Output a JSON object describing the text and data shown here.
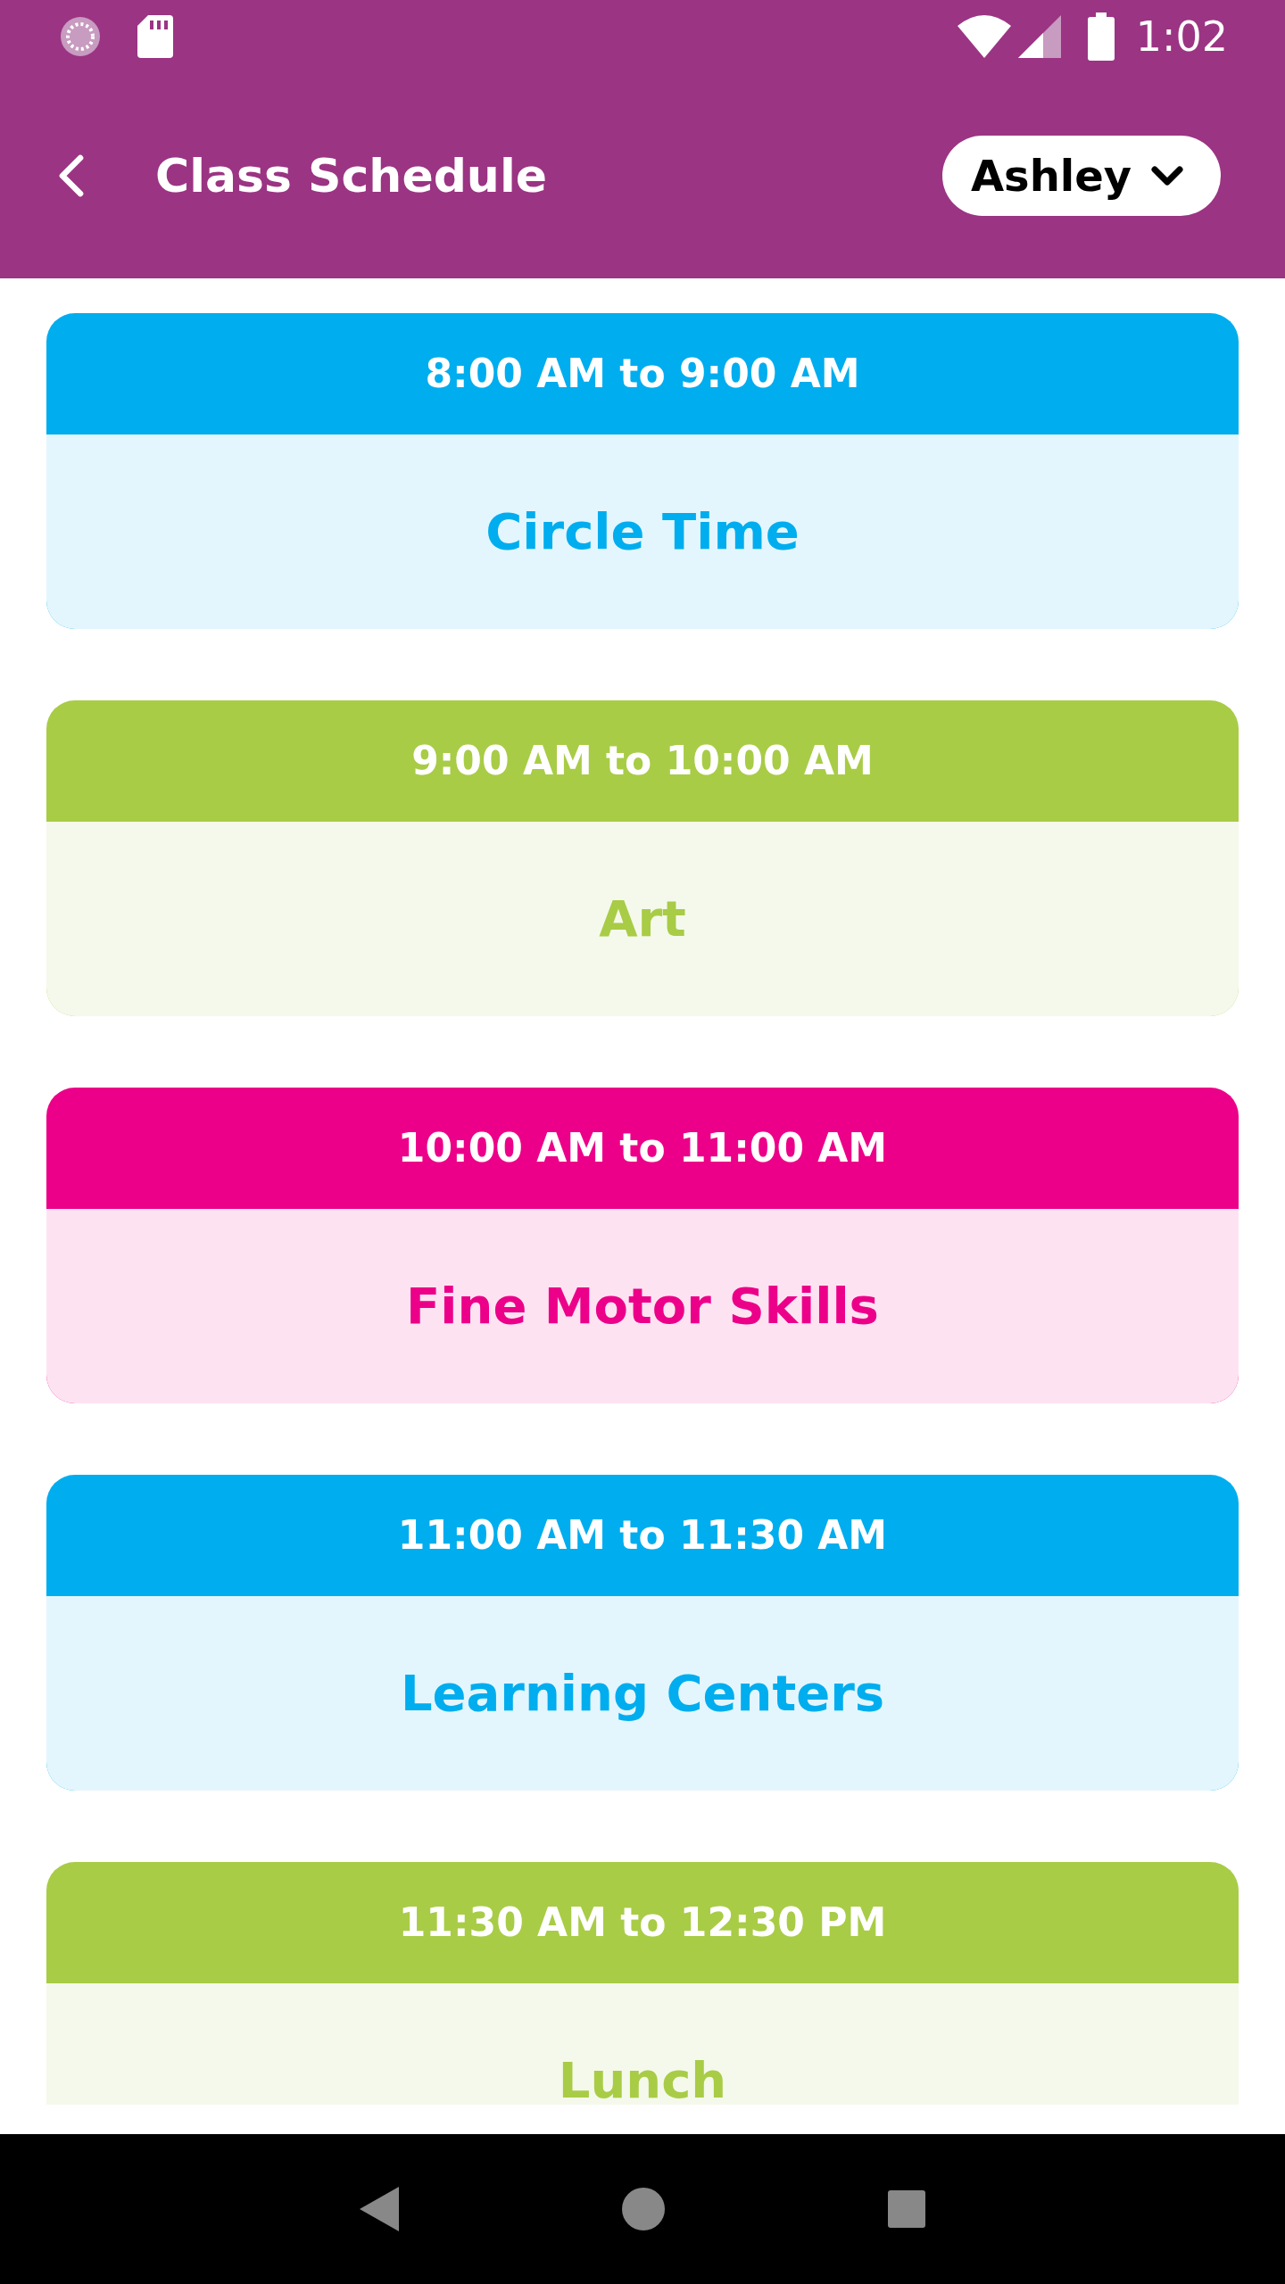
{
  "status_bar": {
    "time": "1:02"
  },
  "header": {
    "title": "Class Schedule",
    "child_selector": "Ashley"
  },
  "schedule": [
    {
      "time": "8:00 AM to 9:00 AM",
      "activity": "Circle Time",
      "color": "#00adee"
    },
    {
      "time": "9:00 AM to 10:00 AM",
      "activity": "Art",
      "color": "#a8cc46"
    },
    {
      "time": "10:00 AM to 11:00 AM",
      "activity": "Fine Motor Skills",
      "color": "#ec0089"
    },
    {
      "time": "11:00 AM to 11:30 AM",
      "activity": "Learning Centers",
      "color": "#00adee"
    },
    {
      "time": "11:30 AM to 12:30 PM",
      "activity": "Lunch",
      "color": "#a8cc46"
    }
  ]
}
